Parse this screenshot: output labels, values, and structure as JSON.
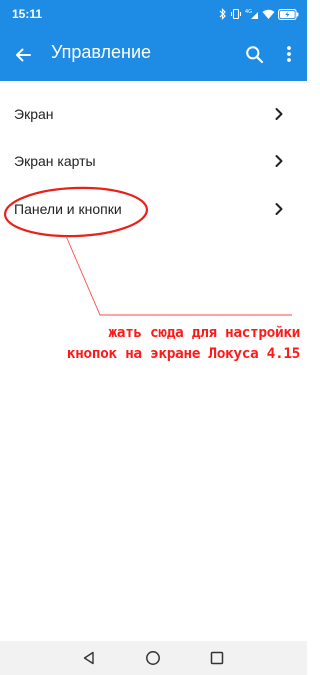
{
  "status_bar": {
    "time": "15:11",
    "icons": [
      "bluetooth-icon",
      "vibrate-icon",
      "signal-4g-icon",
      "wifi-icon",
      "battery-charging-icon"
    ]
  },
  "app_bar": {
    "title": "Управление",
    "color": "#1e8ce4",
    "icons": [
      "back-arrow-icon",
      "search-icon",
      "more-vert-icon"
    ]
  },
  "menu": {
    "items": [
      {
        "label": "Экран"
      },
      {
        "label": "Экран карты"
      },
      {
        "label": "Панели и кнопки"
      }
    ]
  },
  "annotation": {
    "line1": "жать сюда для настройки",
    "line2": "кнопок на экране Локуса 4.15",
    "color": "#ff1a1a"
  },
  "nav_bar": {
    "icons": [
      "nav-back-icon",
      "nav-home-icon",
      "nav-recents-icon"
    ]
  }
}
